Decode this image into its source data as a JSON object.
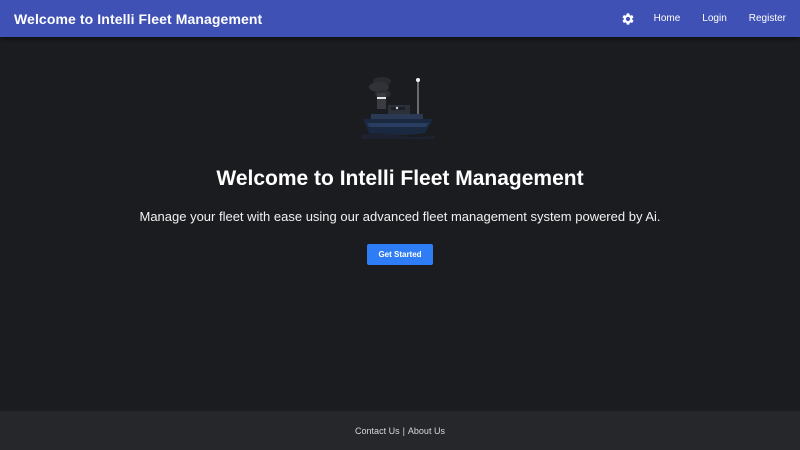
{
  "navbar": {
    "brand": "Welcome to Intelli Fleet Management",
    "theme_toggle_icon": "gear-icon",
    "links": [
      {
        "label": "Home"
      },
      {
        "label": "Login"
      },
      {
        "label": "Register"
      }
    ]
  },
  "hero": {
    "image_icon": "ship-illustration",
    "title": "Welcome to Intelli Fleet Management",
    "subtitle": "Manage your fleet with ease using our advanced fleet management system powered by Ai.",
    "cta_label": "Get Started"
  },
  "footer": {
    "contact_label": "Contact Us",
    "separator": "|",
    "about_label": "About Us"
  },
  "colors": {
    "navbar_bg": "#3f51b5",
    "page_bg": "#1b1c20",
    "footer_bg": "#26272b",
    "cta_bg": "#2f7df6"
  }
}
